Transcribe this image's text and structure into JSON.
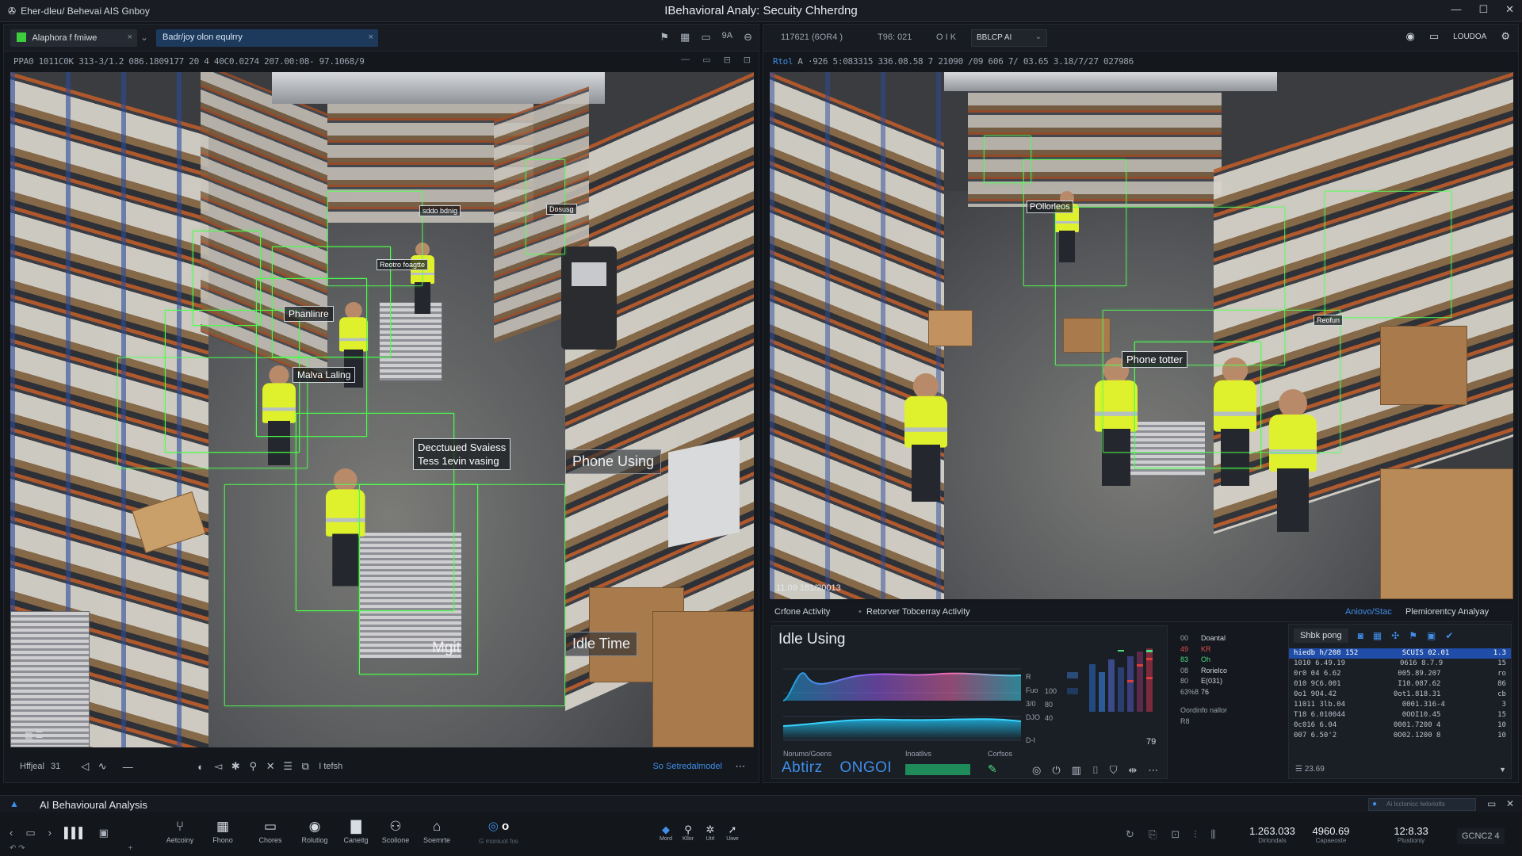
{
  "window": {
    "app_label": "Eher-dleu/ Behevai AIS Gnboy",
    "title": "IBehavioral Analy: Secuity Chherdng"
  },
  "left_pane": {
    "tab1": "Alaphora f fmiwe",
    "tab2": "Badr/joy olon equlrry",
    "tool_zoom": "9A",
    "info": "PPA0 1011C0K  313-3/1.2 086.1809177 20 4 40C0.0274  207.00:08- 97.1068/9",
    "labels": {
      "l1": "Phanlinre",
      "l2": "Malva Laling",
      "l3": "Reotro foagtte",
      "l4a": "Decctuued Svaiess",
      "l4b": "Tess 1evin vasing",
      "l5": "Phone Using",
      "l6": "Idle Time",
      "l7": "Mgit",
      "l8": "sddo bdnig",
      "l9": "Dosusg"
    },
    "bottom": {
      "left": "Hffjeal",
      "count": "31",
      "text": "I tefsh",
      "link": "So Setredalmodel"
    }
  },
  "right_pane": {
    "tb1": "117621 (6OR4 )",
    "tb2": "T96: 021",
    "tb3": "O I K",
    "dropdown": "BBLCP AI",
    "user": "LOUDOA",
    "info_prefix": "Rtol",
    "info": "A  ·926 5:083315 336.08.58  7 21090 /09 606  7/ 03.65 3.18/7/27  027986",
    "timestamp": "11.09 181/20013",
    "labels": {
      "r1": "POllorleos",
      "r2": "Phone totter",
      "r3": "Reofun"
    },
    "tabs": {
      "t1": "Crfone Activity",
      "t2": "Retorver Tobcerray Activity",
      "t3": "Aniovo/Stac",
      "t4": "Plemiorentcy Analyay"
    },
    "chart": {
      "title": "Idle Using",
      "axis": [
        "R",
        "Fuo",
        "3/0",
        "DJO",
        "D-I"
      ],
      "vals": [
        "100",
        "80",
        "40"
      ],
      "label_bottom1": "Norumo/Goens",
      "label_bottom2": "Inoatlivs",
      "label_bottom3": "Corfsos",
      "brand1": "Abtirz",
      "brand2": "ONGOI",
      "n79": "79"
    },
    "stats": {
      "rows": [
        {
          "a": "00",
          "b": "Doantal"
        },
        {
          "a": "49",
          "b": "KR"
        },
        {
          "a": "83",
          "b": "Oh"
        },
        {
          "a": "08",
          "b": "Rorielco"
        },
        {
          "a": "80",
          "b": "E(031)"
        },
        {
          "a": "63%8",
          "b": "76"
        }
      ],
      "foot1": "Oordinfo nallor",
      "foot2": "R8"
    },
    "table": {
      "header": "Shbk pong",
      "rows": [
        {
          "a": "hiedb h/208 152",
          "b": "SCUIS 02.01",
          "c": "1.3"
        },
        {
          "a": "1010 6.49.19",
          "b": "0616 8.7.9",
          "c": "15"
        },
        {
          "a": "0r0 04 6.62",
          "b": "005.89.207",
          "c": "ro"
        },
        {
          "a": "010 9C6.001",
          "b": "I10.087.62",
          "c": "86"
        },
        {
          "a": "0o1 9O4.42",
          "b": "0ot1.818.31",
          "c": "cb"
        },
        {
          "a": "11011 3lb.04",
          "b": "0001.316-4",
          "c": "3"
        },
        {
          "a": "T18 6.010044",
          "b": "0OOI10.45",
          "c": "15"
        },
        {
          "a": "0c016 6.04",
          "b": "0001.7200 4",
          "c": "10"
        },
        {
          "a": "007 6.50'2",
          "b": "0O02.1200 8",
          "c": "10"
        }
      ],
      "footer": "23.69"
    }
  },
  "statusbar": {
    "label": "AI Behavioural Analysis",
    "search_placeholder": "Ai Icclonicc Iwloriotts"
  },
  "taskbar": {
    "buttons": [
      "Aetcoiny",
      "Fhono",
      "Chores",
      "Rolutiog",
      "Caneitg",
      "Scolione",
      "Soemrte"
    ],
    "o_value": "o",
    "o_caption": "G moniuot fos",
    "small": [
      "Mord",
      "Kllor",
      "Utrl",
      "Uiwe"
    ],
    "stats": [
      {
        "v": "1.263.033",
        "c": "Dirlondals"
      },
      {
        "v": "4960.69",
        "c": "Capaeoste"
      },
      {
        "v": "12:8.33",
        "c": "Plustioniy"
      }
    ],
    "end": "GCNC2 4"
  }
}
